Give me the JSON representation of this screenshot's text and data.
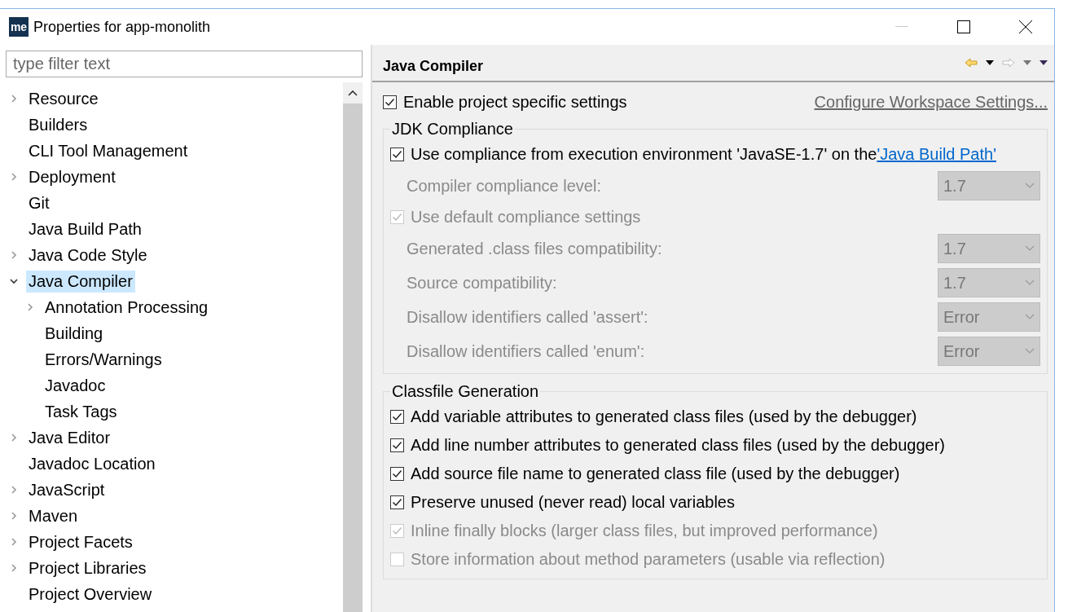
{
  "window": {
    "title": "Properties for app-monolith",
    "app_icon_text": "me"
  },
  "filter": {
    "placeholder": "type filter text"
  },
  "tree": [
    {
      "label": "Resource",
      "expanded": false,
      "selected": false
    },
    {
      "label": "Builders",
      "selected": false
    },
    {
      "label": "CLI Tool Management",
      "selected": false
    },
    {
      "label": "Deployment",
      "expanded": false,
      "selected": false
    },
    {
      "label": "Git",
      "selected": false
    },
    {
      "label": "Java Build Path",
      "selected": false
    },
    {
      "label": "Java Code Style",
      "expanded": false,
      "selected": false
    },
    {
      "label": "Java Compiler",
      "expanded": true,
      "selected": true,
      "children": [
        {
          "label": "Annotation Processing",
          "expanded": false,
          "selected": false
        },
        {
          "label": "Building",
          "selected": false
        },
        {
          "label": "Errors/Warnings",
          "selected": false
        },
        {
          "label": "Javadoc",
          "selected": false
        },
        {
          "label": "Task Tags",
          "selected": false
        }
      ]
    },
    {
      "label": "Java Editor",
      "expanded": false,
      "selected": false
    },
    {
      "label": "Javadoc Location",
      "selected": false
    },
    {
      "label": "JavaScript",
      "expanded": false,
      "selected": false
    },
    {
      "label": "Maven",
      "expanded": false,
      "selected": false
    },
    {
      "label": "Project Facets",
      "expanded": false,
      "selected": false
    },
    {
      "label": "Project Libraries",
      "expanded": false,
      "selected": false
    },
    {
      "label": "Project Overview",
      "selected": false
    }
  ],
  "page": {
    "title": "Java Compiler",
    "enable": {
      "label": "Enable project specific settings",
      "checked": true
    },
    "workspace_link": "Configure Workspace Settings...",
    "groups": [
      {
        "title": "JDK Compliance",
        "rows": [
          {
            "kind": "checkbox",
            "label": "Use compliance from execution environment 'JavaSE-1.7' on the ",
            "link": "'Java Build Path'",
            "checked": true,
            "disabled": false
          },
          {
            "kind": "select",
            "label": "Compiler compliance level:",
            "value": "1.7",
            "disabled": true
          },
          {
            "kind": "checkbox",
            "label": "Use default compliance settings",
            "checked": true,
            "disabled": true,
            "children": [
              {
                "kind": "select",
                "label": "Generated .class files compatibility:",
                "value": "1.7",
                "disabled": true
              },
              {
                "kind": "select",
                "label": "Source compatibility:",
                "value": "1.7",
                "disabled": true
              },
              {
                "kind": "select",
                "label": "Disallow identifiers called 'assert':",
                "value": "Error",
                "disabled": true
              },
              {
                "kind": "select",
                "label": "Disallow identifiers called 'enum':",
                "value": "Error",
                "disabled": true
              }
            ]
          }
        ]
      },
      {
        "title": "Classfile Generation",
        "rows": [
          {
            "kind": "checkbox",
            "label": "Add variable attributes to generated class files (used by the debugger)",
            "checked": true,
            "disabled": false
          },
          {
            "kind": "checkbox",
            "label": "Add line number attributes to generated class files (used by the debugger)",
            "checked": true,
            "disabled": false
          },
          {
            "kind": "checkbox",
            "label": "Add source file name to generated class file (used by the debugger)",
            "checked": true,
            "disabled": false
          },
          {
            "kind": "checkbox",
            "label": "Preserve unused (never read) local variables",
            "checked": true,
            "disabled": false
          },
          {
            "kind": "checkbox",
            "label": "Inline finally blocks (larger class files, but improved performance)",
            "checked": true,
            "disabled": true
          },
          {
            "kind": "checkbox",
            "label": "Store information about method parameters (usable via reflection)",
            "checked": false,
            "disabled": true
          }
        ]
      }
    ]
  }
}
